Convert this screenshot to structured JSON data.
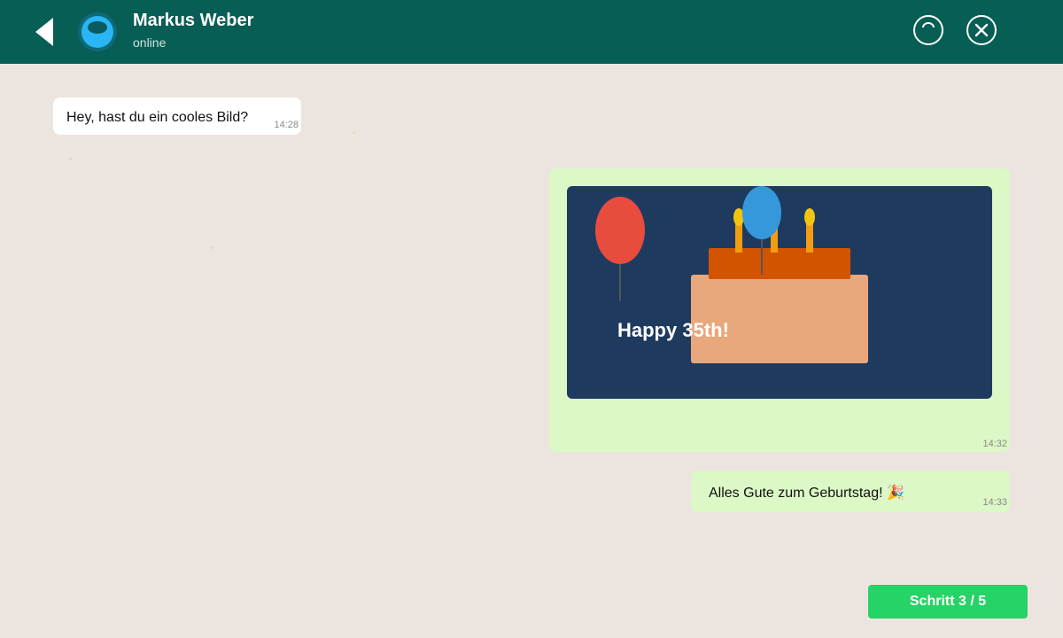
{
  "header": {
    "contact_name": "Markus Weber",
    "status": "online",
    "background_color": "#075e54",
    "icons": {
      "back": "back-arrow-icon",
      "avatar": "avatar",
      "loading": "loading-spinner-icon",
      "close": "close-icon"
    }
  },
  "messages": [
    {
      "direction": "incoming",
      "text": "Hey, hast du ein cooles Bild?",
      "time": "14:28"
    },
    {
      "direction": "outgoing",
      "type": "image",
      "image_text": "Happy 35th!",
      "time": "14:32"
    },
    {
      "direction": "outgoing",
      "text": "Alles Gute zum Geburtstag! 🎉",
      "time": "14:33"
    }
  ],
  "footer": {
    "step_label": "Schritt 3 / 5"
  },
  "colors": {
    "chat_background": "#ece5df",
    "incoming_bubble": "#ffffff",
    "outgoing_bubble": "#dcf8c6",
    "step_button": "#25d366"
  }
}
